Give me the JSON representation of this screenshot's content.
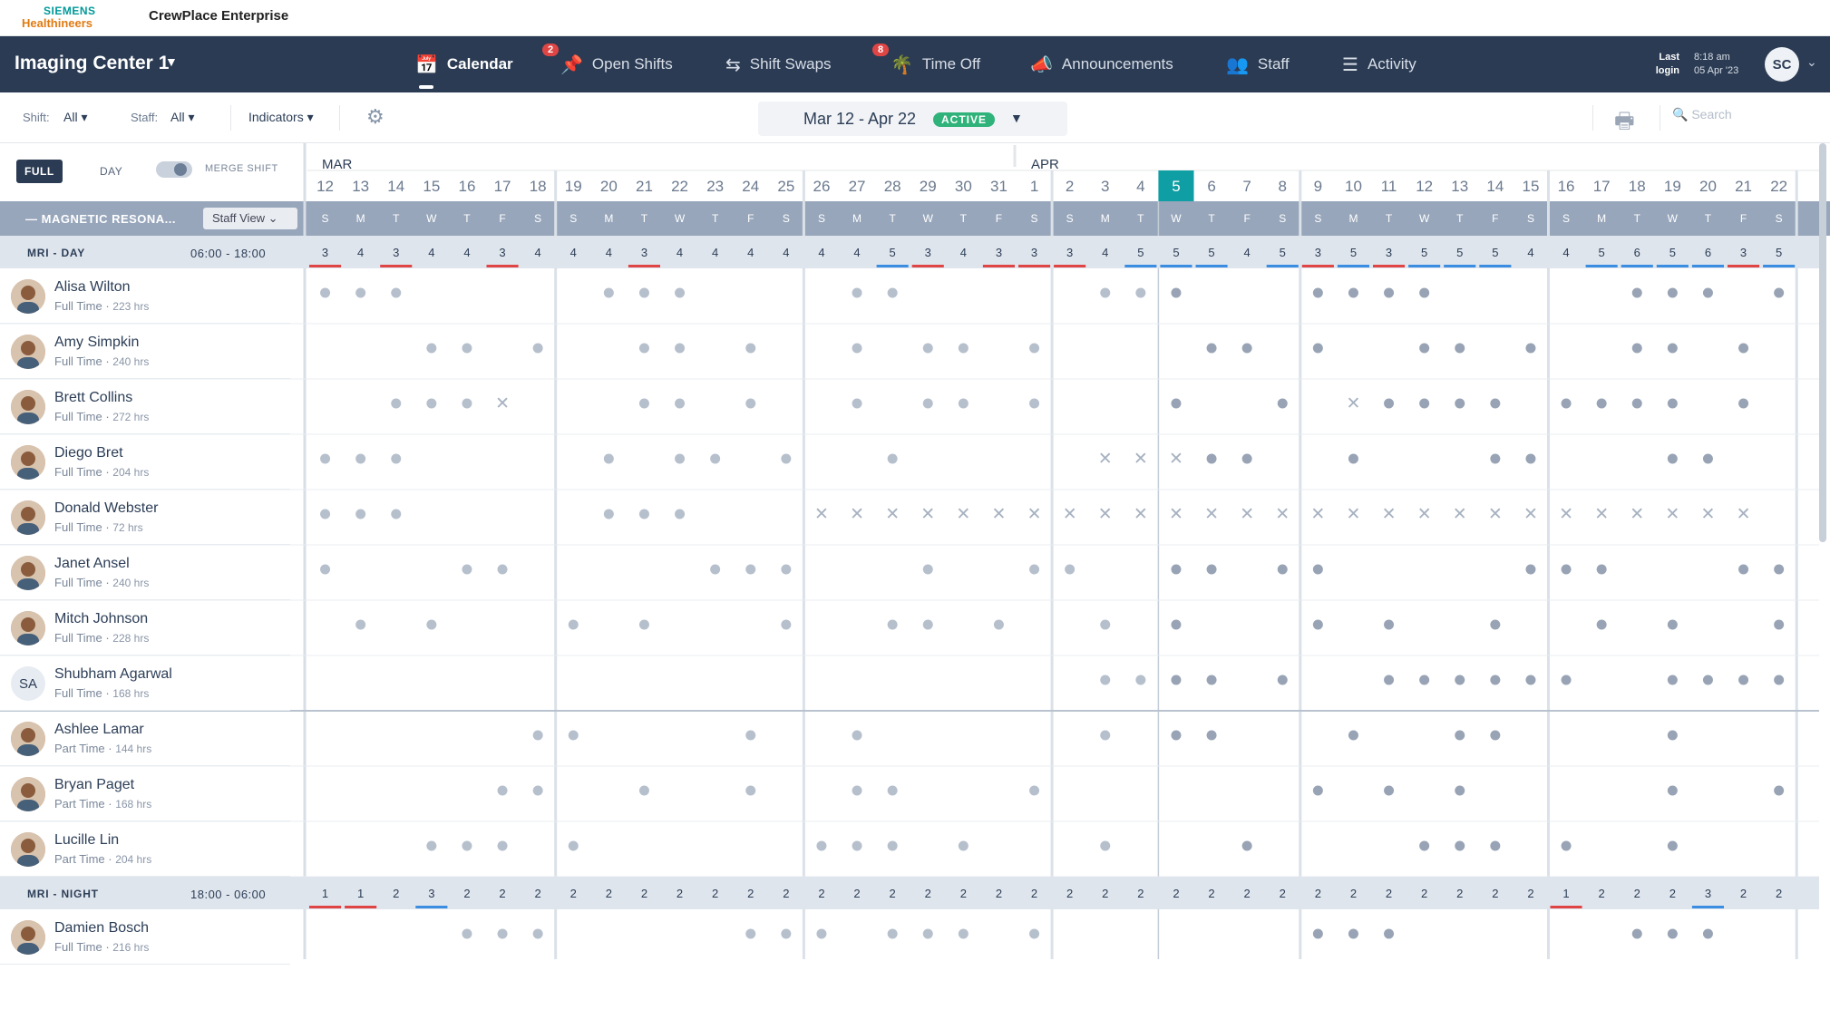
{
  "brand": {
    "logo_top": "SIEMENS",
    "logo_bottom": "Healthineers",
    "app": "CrewPlace Enterprise"
  },
  "nav": {
    "location": "Imaging Center 1",
    "items": [
      {
        "label": "Calendar",
        "icon": "calendar-icon",
        "badge": ""
      },
      {
        "label": "Open Shifts",
        "icon": "pin-icon",
        "badge": "2"
      },
      {
        "label": "Shift Swaps",
        "icon": "swap-icon",
        "badge": ""
      },
      {
        "label": "Time Off",
        "icon": "palm-tree-icon",
        "badge": "8"
      },
      {
        "label": "Announcements",
        "icon": "megaphone-icon",
        "badge": ""
      },
      {
        "label": "Staff",
        "icon": "people-icon",
        "badge": ""
      },
      {
        "label": "Activity",
        "icon": "list-icon",
        "badge": ""
      }
    ],
    "last_login_label": "Last login",
    "last_login_time": "8:18 am",
    "last_login_date": "05 Apr '23",
    "avatar": "SC"
  },
  "filters": {
    "shift_label": "Shift:",
    "shift_value": "All",
    "staff_label": "Staff:",
    "staff_value": "All",
    "indicators": "Indicators",
    "date_range": "Mar 12 - Apr 22",
    "status": "ACTIVE",
    "search_placeholder": "Search"
  },
  "view": {
    "full": "FULL",
    "day": "DAY",
    "merge": "MERGE SHIFT"
  },
  "months": [
    {
      "label": "MAR",
      "start": 0
    },
    {
      "label": "APR",
      "start": 20
    }
  ],
  "days": [
    "12",
    "13",
    "14",
    "15",
    "16",
    "17",
    "18",
    "19",
    "20",
    "21",
    "22",
    "23",
    "24",
    "25",
    "26",
    "27",
    "28",
    "29",
    "30",
    "31",
    "1",
    "2",
    "3",
    "4",
    "5",
    "6",
    "7",
    "8",
    "9",
    "10",
    "11",
    "12",
    "13",
    "14",
    "15",
    "16",
    "17",
    "18",
    "19",
    "20",
    "21",
    "22"
  ],
  "weekdays": [
    "S",
    "M",
    "T",
    "W",
    "T",
    "F",
    "S"
  ],
  "today_index": 24,
  "group": {
    "label": "MAGNETIC RESONA...",
    "view": "Staff View"
  },
  "shifts": [
    {
      "name": "MRI - DAY",
      "time": "06:00 - 18:00",
      "counts": [
        3,
        4,
        3,
        4,
        4,
        3,
        4,
        4,
        4,
        3,
        4,
        4,
        4,
        4,
        4,
        4,
        5,
        3,
        4,
        3,
        3,
        3,
        4,
        5,
        5,
        5,
        4,
        5,
        3,
        5,
        3,
        5,
        5,
        5,
        4,
        4,
        5,
        6,
        5,
        6,
        3,
        5
      ],
      "bars": [
        1,
        0,
        1,
        0,
        0,
        1,
        0,
        0,
        0,
        1,
        0,
        0,
        0,
        0,
        0,
        0,
        2,
        1,
        0,
        1,
        1,
        1,
        0,
        2,
        2,
        2,
        0,
        2,
        1,
        2,
        1,
        2,
        2,
        2,
        0,
        0,
        2,
        2,
        2,
        2,
        1,
        2
      ]
    },
    {
      "name": "MRI - NIGHT",
      "time": "18:00 - 06:00",
      "counts": [
        1,
        1,
        2,
        3,
        2,
        2,
        2,
        2,
        2,
        2,
        2,
        2,
        2,
        2,
        2,
        2,
        2,
        2,
        2,
        2,
        2,
        2,
        2,
        2,
        2,
        2,
        2,
        2,
        2,
        2,
        2,
        2,
        2,
        2,
        2,
        1,
        2,
        2,
        2,
        3,
        2,
        2
      ],
      "bars": [
        1,
        1,
        0,
        2,
        0,
        0,
        0,
        0,
        0,
        0,
        0,
        0,
        0,
        0,
        0,
        0,
        0,
        0,
        0,
        0,
        0,
        0,
        0,
        0,
        0,
        0,
        0,
        0,
        0,
        0,
        0,
        0,
        0,
        0,
        0,
        1,
        0,
        0,
        0,
        2,
        0,
        0
      ]
    }
  ],
  "staff": [
    {
      "name": "Alisa Wilton",
      "type": "Full Time",
      "hours": "223 hrs",
      "initials": "",
      "cells": "DDD.....DDD....DD.....DDD...DDDD.....DDD.D."
    },
    {
      "name": "Amy Simpkin",
      "type": "Full Time",
      "hours": "240 hrs",
      "initials": "",
      "cells": "...DD.D..DD.D..D.DD.D....DD.D..DD.D..DD.D."
    },
    {
      "name": "Brett Collins",
      "type": "Full Time",
      "hours": "272 hrs",
      "initials": "",
      "cells": "..DDDX...DD.D..D.DD.D...D..D.XDDDD.DDDD.D"
    },
    {
      "name": "Diego Bret",
      "type": "Full Time",
      "hours": "204 hrs",
      "initials": "",
      "cells": "DDD.....D.DD.D..D.....XXXDD..D...DD...DD..."
    },
    {
      "name": "Donald Webster",
      "type": "Full Time",
      "hours": "72 hrs",
      "initials": "",
      "cells": "DDD.....DDD...XXXXXXXXXXXXXXXXXXXXXXXXXXX"
    },
    {
      "name": "Janet Ansel",
      "type": "Full Time",
      "hours": "240 hrs",
      "initials": "",
      "cells": "D...DD.....DDD...D..DD..DD.DD.....DDD...DDD"
    },
    {
      "name": "Mitch Johnson",
      "type": "Full Time",
      "hours": "228 hrs",
      "initials": "",
      "cells": ".D.D...D.D...D..DD.D..D.D...D.D..D..D.D..D.D"
    },
    {
      "name": "Shubham Agarwal",
      "type": "Full Time",
      "hours": "168 hrs",
      "initials": "SA",
      "cells": "......................DDDD.D..DDDDDD..DDDD.D"
    },
    {
      "name": "Ashlee Lamar",
      "type": "Part Time",
      "hours": "144 hrs",
      "initials": "",
      "cells": "......DD....D..D......D.DD...D..DD....D...D."
    },
    {
      "name": "Bryan Paget",
      "type": "Part Time",
      "hours": "168 hrs",
      "initials": "",
      "cells": ".....DD..D..D..DD...D.......D.D.D.....D..D.D"
    },
    {
      "name": "Lucille Lin",
      "type": "Part Time",
      "hours": "204 hrs",
      "initials": "",
      "cells": "...DDD.D......DDD.D...D...D....DDD.D..D...DD"
    },
    {
      "name": "Damien Bosch",
      "type": "Full Time",
      "hours": "216 hrs",
      "initials": "",
      "cells": "....DDD.....DDD.DDD.D.......DDD......DDD...DDD"
    }
  ],
  "colors": {
    "nav": "#2b3b53",
    "today": "#0f9ea3",
    "dot": "#9aa6b6",
    "over": "#e04545",
    "under": "#3a8de0"
  }
}
